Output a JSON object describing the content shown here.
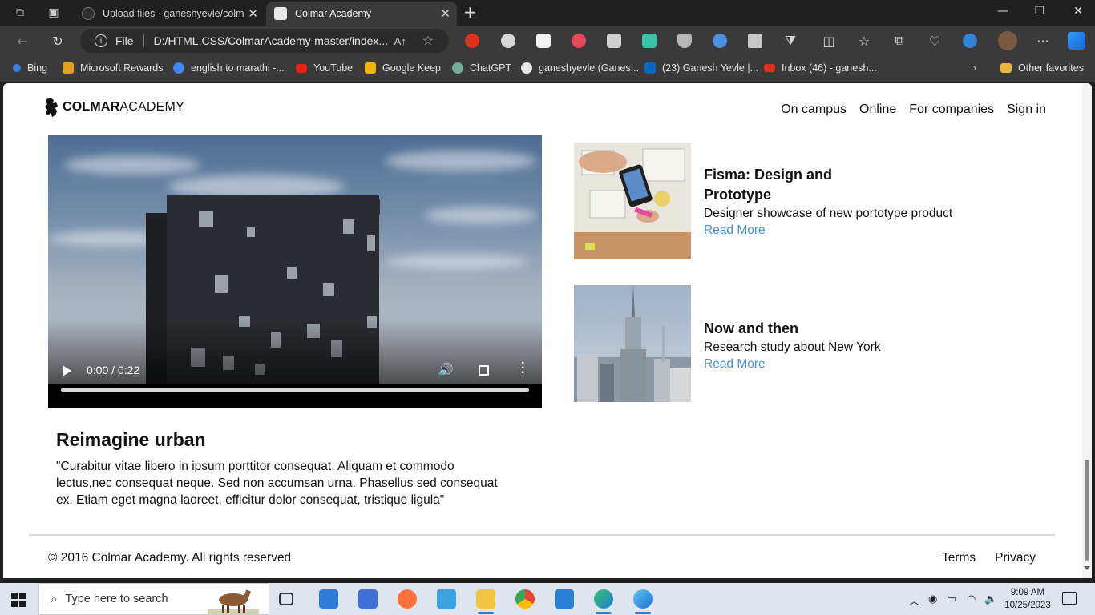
{
  "browser": {
    "tabs": [
      {
        "title": "Upload files · ganeshyevle/colmar",
        "active": false
      },
      {
        "title": "Colmar Academy",
        "active": true
      }
    ],
    "address": {
      "label": "File",
      "url": "D:/HTML,CSS/ColmarAcademy-master/index...."
    },
    "favorites": [
      {
        "label": "Bing",
        "color": "#3d7fe0"
      },
      {
        "label": "Microsoft Rewards",
        "color": "#e3a21a"
      },
      {
        "label": "english to marathi -...",
        "color": "#4285f4"
      },
      {
        "label": "YouTube",
        "color": "#e62117"
      },
      {
        "label": "Google Keep",
        "color": "#f5b400"
      },
      {
        "label": "ChatGPT",
        "color": "#74aa9c"
      },
      {
        "label": "ganeshyevle (Ganes...",
        "color": "#e8e8e8"
      },
      {
        "label": "(23) Ganesh Yevle |...",
        "color": "#0a66c2"
      },
      {
        "label": "Inbox (46) - ganesh...",
        "color": "#d93025"
      }
    ],
    "other_favorites": "Other favorites"
  },
  "page": {
    "brand": {
      "bold": "COLMAR",
      "light": "ACADEMY"
    },
    "nav": [
      "On campus",
      "Online",
      "For companies",
      "Sign in"
    ],
    "video": {
      "time": "0:00 / 0:22"
    },
    "feature": {
      "title": "Reimagine urban",
      "body": "\"Curabitur vitae libero in ipsum porttitor consequat. Aliquam et commodo lectus,nec consequat neque. Sed non accumsan urna. Phasellus sed consequat ex. Etiam eget magna laoreet, efficitur dolor consequat, tristique ligula\""
    },
    "cards": [
      {
        "title": "Fisma: Design and Prototype",
        "desc": "Designer showcase of new portotype product",
        "link": "Read More"
      },
      {
        "title": "Now and then",
        "desc": "Research study about New York",
        "link": "Read More"
      }
    ],
    "footer": {
      "copyright": "© 2016 Colmar Academy. All rights reserved",
      "links": [
        "Terms",
        "Privacy"
      ]
    }
  },
  "taskbar": {
    "search_placeholder": "Type here to search",
    "time": "9:09 AM",
    "date": "10/25/2023"
  },
  "colors": {
    "link": "#4a8fd8",
    "accent": "#3a7bd5"
  }
}
